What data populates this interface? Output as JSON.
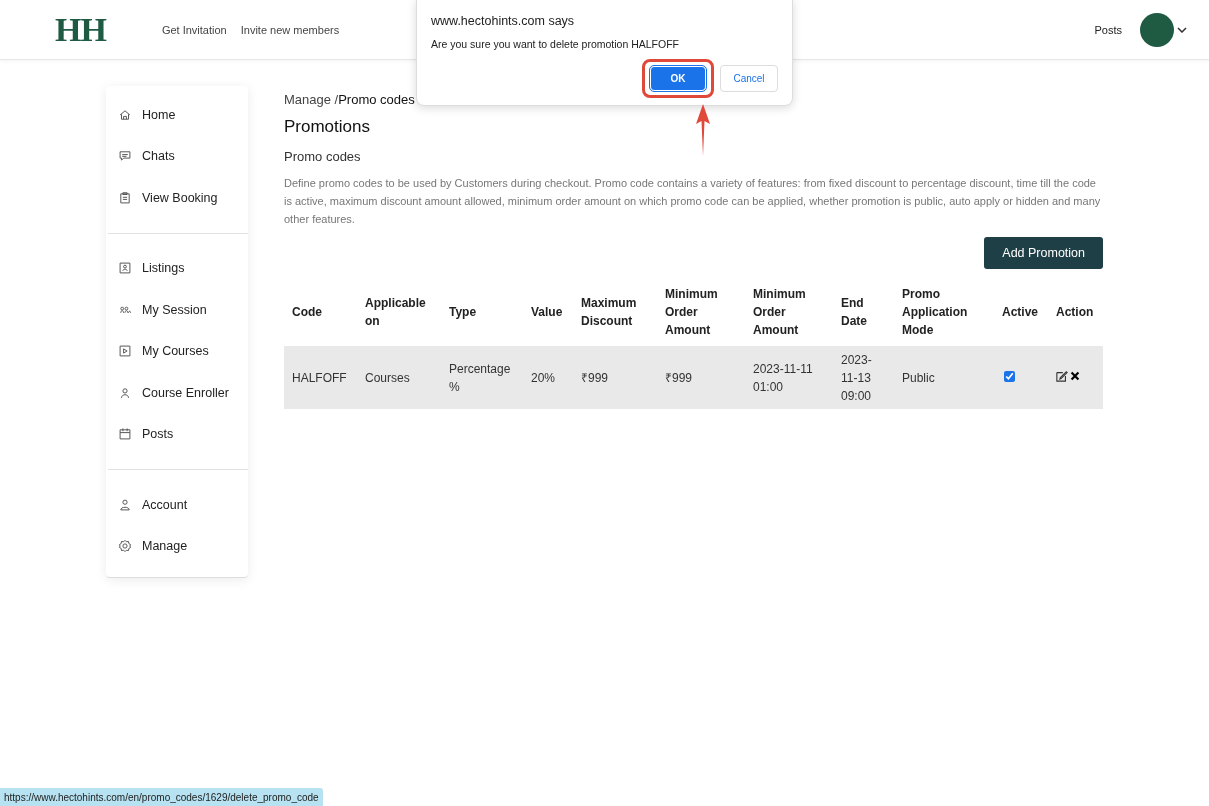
{
  "header": {
    "logo": "HH",
    "nav": [
      "Get Invitation",
      "Invite new members"
    ],
    "right_link": "Posts"
  },
  "sidebar": {
    "groups": [
      [
        "Home",
        "Chats",
        "View Booking"
      ],
      [
        "Listings",
        "My Session",
        "My Courses",
        "Course Enroller",
        "Posts"
      ],
      [
        "Account",
        "Manage"
      ]
    ]
  },
  "breadcrumb": {
    "parent": "Manage /",
    "current": "Promo codes"
  },
  "page_title": "Promotions",
  "section_title": "Promo codes",
  "description": "Define promo codes to be used by Customers during checkout. Promo code contains a variety of features: from fixed discount to percentage discount, time till the code is active, maximum discount amount allowed, minimum order amount on which promo code can be applied, whether promotion is public, auto apply or hidden and many other features.",
  "add_button": "Add Promotion",
  "table": {
    "columns": [
      "Code",
      "Applicable on",
      "Type",
      "Value",
      "Maximum Discount",
      "Minimum Order Amount",
      "Minimum Order Amount",
      "End Date",
      "Promo Application Mode",
      "Active",
      "Action"
    ],
    "rows": [
      {
        "cells": [
          "HALFOFF",
          "Courses",
          "Percentage %",
          "20%",
          "₹999",
          "₹999",
          "2023-11-11 01:00",
          "2023-11-13 09:00",
          "Public"
        ],
        "active": true
      }
    ]
  },
  "dialog": {
    "title": "www.hectohints.com says",
    "message": "Are you sure you want to delete promotion HALFOFF",
    "ok": "OK",
    "cancel": "Cancel"
  },
  "status_url": "https://www.hectohints.com/en/promo_codes/1629/delete_promo_code"
}
